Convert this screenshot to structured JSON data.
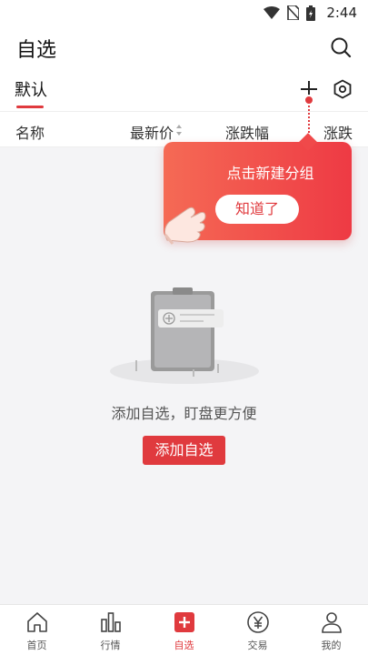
{
  "status_bar": {
    "time": "2:44",
    "icons": [
      "wifi-icon",
      "no-sim-icon",
      "battery-icon"
    ]
  },
  "header": {
    "title": "自选",
    "search_icon": "search-icon"
  },
  "tabs": {
    "default_tab": "默认",
    "add_icon": "plus-icon",
    "settings_icon": "settings-hex-icon"
  },
  "columns": {
    "name": "名称",
    "price": "最新价",
    "change": "涨跌幅",
    "change2": "涨跌"
  },
  "tooltip": {
    "text": "点击新建分组",
    "button": "知道了"
  },
  "empty": {
    "text": "添加自选，盯盘更方便",
    "button": "添加自选"
  },
  "nav": [
    {
      "label": "首页",
      "icon": "home-icon"
    },
    {
      "label": "行情",
      "icon": "bar-chart-icon"
    },
    {
      "label": "自选",
      "icon": "plus-box-icon",
      "active": true
    },
    {
      "label": "交易",
      "icon": "yen-icon"
    },
    {
      "label": "我的",
      "icon": "person-icon"
    }
  ],
  "colors": {
    "accent": "#e03a3e",
    "tooltip_start": "#f56a55",
    "tooltip_end": "#ee3a44"
  }
}
